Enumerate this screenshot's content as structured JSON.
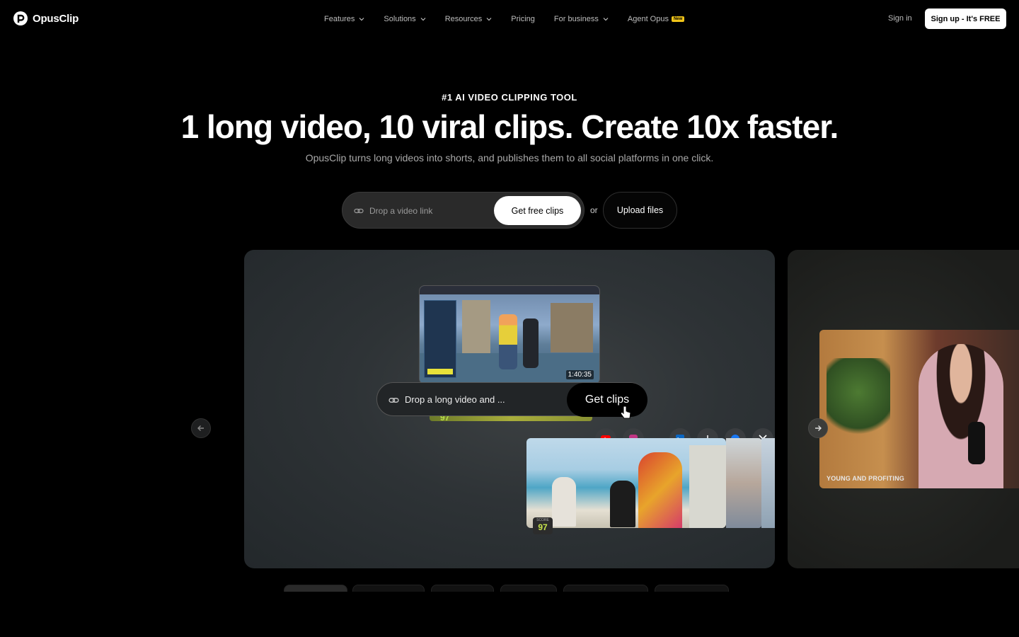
{
  "brand": {
    "name": "OpusClip"
  },
  "nav": {
    "items": [
      {
        "label": "Features",
        "dropdown": true
      },
      {
        "label": "Solutions",
        "dropdown": true
      },
      {
        "label": "Resources",
        "dropdown": true
      },
      {
        "label": "Pricing",
        "dropdown": false
      },
      {
        "label": "For business",
        "dropdown": true
      },
      {
        "label": "Agent Opus",
        "dropdown": false,
        "badge": "New"
      }
    ],
    "signin": "Sign in",
    "signup": "Sign up - It's FREE"
  },
  "hero": {
    "eyebrow": "#1 AI VIDEO CLIPPING TOOL",
    "headline": "1 long video, 10 viral clips. Create 10x faster.",
    "subtitle": "OpusClip turns long videos into shorts, and publishes them to all social platforms in one click.",
    "input_placeholder": "Drop a video link",
    "cta": "Get free clips",
    "or": "or",
    "upload": "Upload files"
  },
  "showcase": {
    "timecode": "1:40:35",
    "drop_text": "Drop a long video and ...",
    "get_clips": "Get clips",
    "score_top": "97",
    "score_label": "SCORE",
    "score_main": "97",
    "socials": [
      "youtube-icon",
      "instagram-icon",
      "linkedin-icon",
      "tiktok-icon",
      "facebook-icon",
      "x-icon"
    ],
    "second_caption": "YOUNG AND PROFITING"
  },
  "colors": {
    "background": "#000000",
    "accent": "#c8e64c",
    "badge": "#f0c419"
  }
}
